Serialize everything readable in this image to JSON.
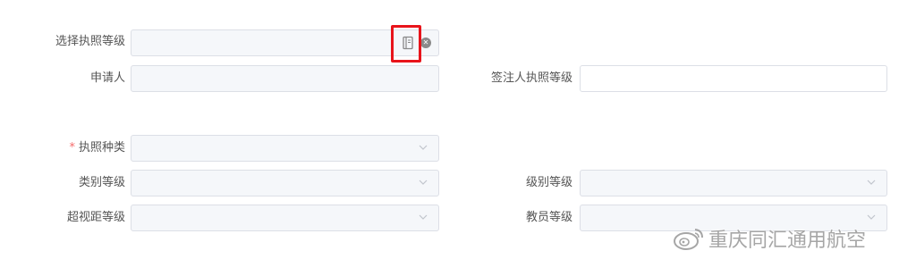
{
  "form": {
    "license_level": {
      "label": "选择执照等级",
      "value": ""
    },
    "applicant": {
      "label": "申请人",
      "value": ""
    },
    "signer_level": {
      "label": "签注人执照等级",
      "value": ""
    },
    "license_type": {
      "label": "执照种类",
      "required_mark": "*",
      "value": ""
    },
    "category_level": {
      "label": "类别等级",
      "value": ""
    },
    "class_level": {
      "label": "级别等级",
      "value": ""
    },
    "bvlos_level": {
      "label": "超视距等级",
      "value": ""
    },
    "instructor_level": {
      "label": "教员等级",
      "value": ""
    }
  },
  "icons": {
    "picker": "book-icon",
    "clear": "clear-icon",
    "dropdown": "chevron-down-icon",
    "watermark_logo": "weibo-icon"
  },
  "colors": {
    "highlight": "#e8141b",
    "required": "#f56c6c",
    "disabled_bg": "#f5f7fa",
    "border": "#dcdfe6"
  },
  "watermark": {
    "text": "重庆同汇通用航空"
  }
}
